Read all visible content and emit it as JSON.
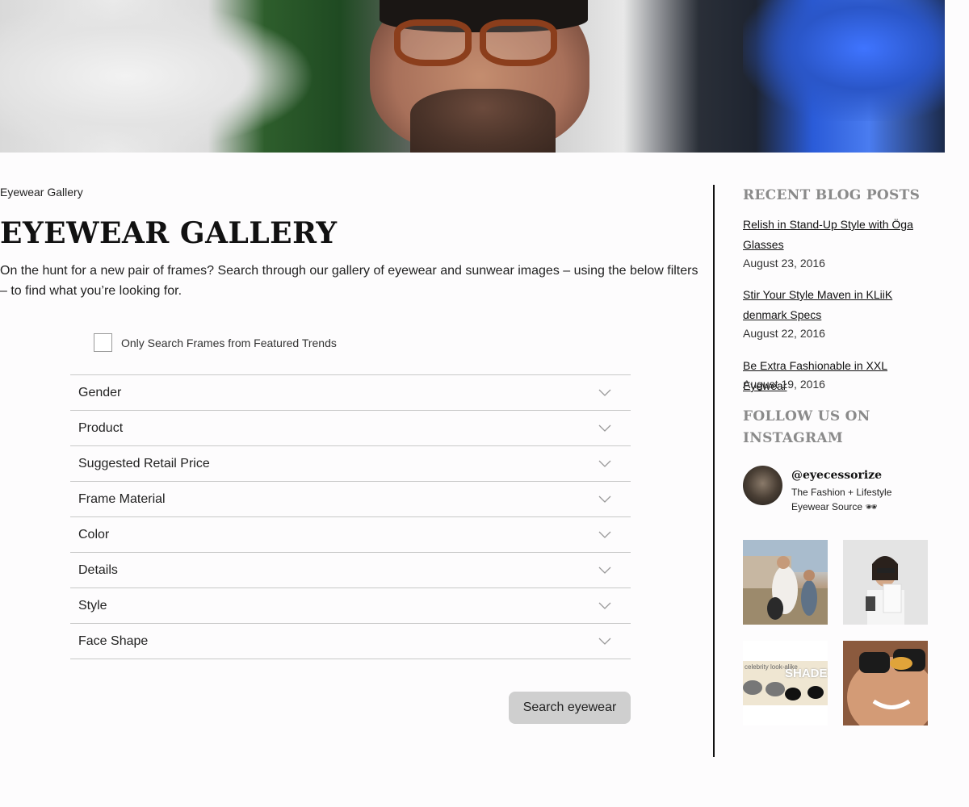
{
  "page": {
    "breadcrumb": "Eyewear Gallery",
    "title": "EYEWEAR GALLERY",
    "intro": "On the hunt for a new pair of frames? Search through our gallery of eyewear and sunwear images – using the below filters – to find what you’re looking for."
  },
  "search_form": {
    "featured_checkbox_label": "Only Search Frames from Featured Trends",
    "featured_checked": false,
    "filters": [
      "Gender",
      "Product",
      "Suggested Retail Price",
      "Frame Material",
      "Color",
      "Details",
      "Style",
      "Face Shape"
    ],
    "search_button": "Search eyewear"
  },
  "sidebar": {
    "recent_heading": "RECENT BLOG POSTS",
    "posts": [
      {
        "title": "Relish in Stand-Up Style with Öga Glasses",
        "date": "August 23, 2016"
      },
      {
        "title": "Stir Your Style Maven in KLiiK denmark Specs",
        "date": "August 22, 2016"
      },
      {
        "title": "Be Extra Fashionable in XXL Eyewear",
        "date": "August 19, 2016"
      }
    ],
    "instagram_heading_line1": "FOLLOW US ON",
    "instagram_heading_line2": "INSTAGRAM",
    "instagram": {
      "handle": "@eyecessorize",
      "bio": "The Fashion + Lifestyle Eyewear Source 🕶"
    },
    "thumb_texts": {
      "t3_small": "celebrity look-alike",
      "t3_big": "SHADES"
    }
  },
  "colors": {
    "heading_gray": "#8a8a8a",
    "button_gray": "#cfcfcf",
    "divider": "#111111"
  }
}
